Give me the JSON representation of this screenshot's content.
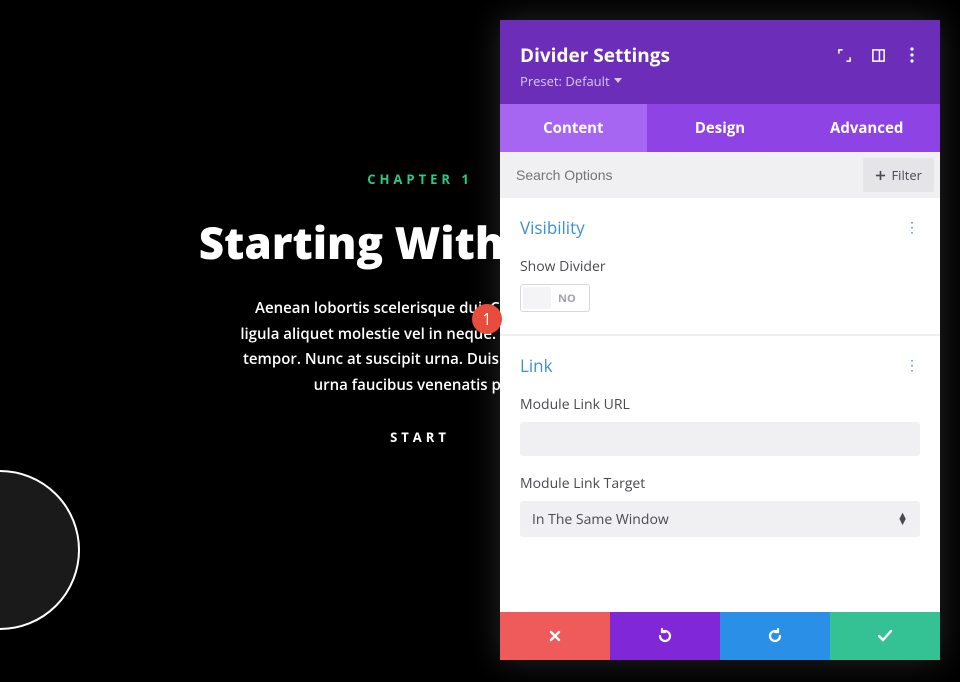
{
  "page": {
    "chapter": "CHAPTER 1",
    "title": "Starting With Th",
    "paragraph": "Aenean lobortis scelerisque dui. Cras ut erat t\nligula aliquet molestie vel in neque. Maecenas ma\ntempor. Nunc at suscipit urna. Duis convallis mol\nurna faucibus venenatis phas",
    "cta": "START"
  },
  "badge": "1",
  "modal": {
    "title": "Divider Settings",
    "preset": "Preset: Default",
    "tabs": [
      "Content",
      "Design",
      "Advanced"
    ],
    "search_placeholder": "Search Options",
    "filter_label": "Filter",
    "sections": {
      "visibility": {
        "title": "Visibility",
        "field_label": "Show Divider",
        "toggle_value": "NO"
      },
      "link": {
        "title": "Link",
        "url_label": "Module Link URL",
        "url_value": "",
        "target_label": "Module Link Target",
        "target_value": "In The Same Window"
      }
    }
  }
}
